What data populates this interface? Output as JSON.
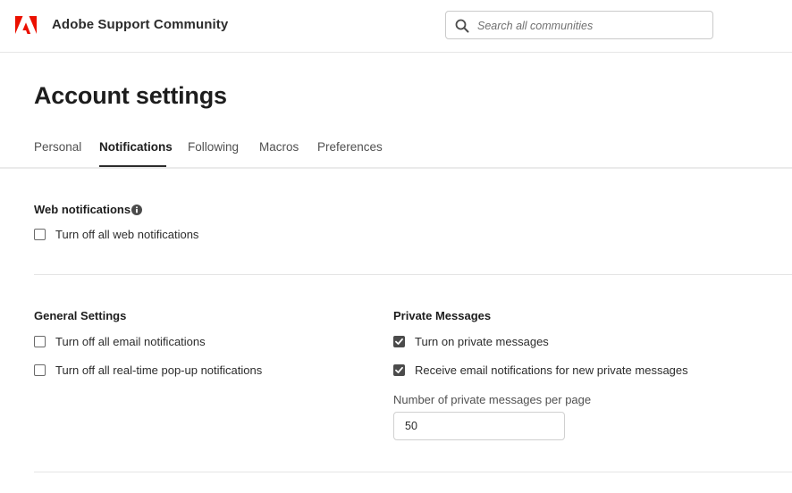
{
  "header": {
    "brand": "Adobe Support Community",
    "logo_color": "#eb1000",
    "search_placeholder": "Search all communities"
  },
  "page": {
    "title": "Account settings"
  },
  "tabs": [
    {
      "label": "Personal",
      "active": false
    },
    {
      "label": "Notifications",
      "active": true
    },
    {
      "label": "Following",
      "active": false
    },
    {
      "label": "Macros",
      "active": false
    },
    {
      "label": "Preferences",
      "active": false
    }
  ],
  "web_notifications": {
    "heading": "Web notifications",
    "info_icon": "info-icon",
    "options": [
      {
        "label": "Turn off all web notifications",
        "checked": false
      }
    ]
  },
  "general_settings": {
    "heading": "General Settings",
    "options": [
      {
        "label": "Turn off all email notifications",
        "checked": false
      },
      {
        "label": "Turn off all real-time pop-up notifications",
        "checked": false
      }
    ]
  },
  "private_messages": {
    "heading": "Private Messages",
    "options": [
      {
        "label": "Turn on private messages",
        "checked": true
      },
      {
        "label": "Receive email notifications for new private messages",
        "checked": true
      }
    ],
    "per_page_label": "Number of private messages per page",
    "per_page_value": "50"
  }
}
